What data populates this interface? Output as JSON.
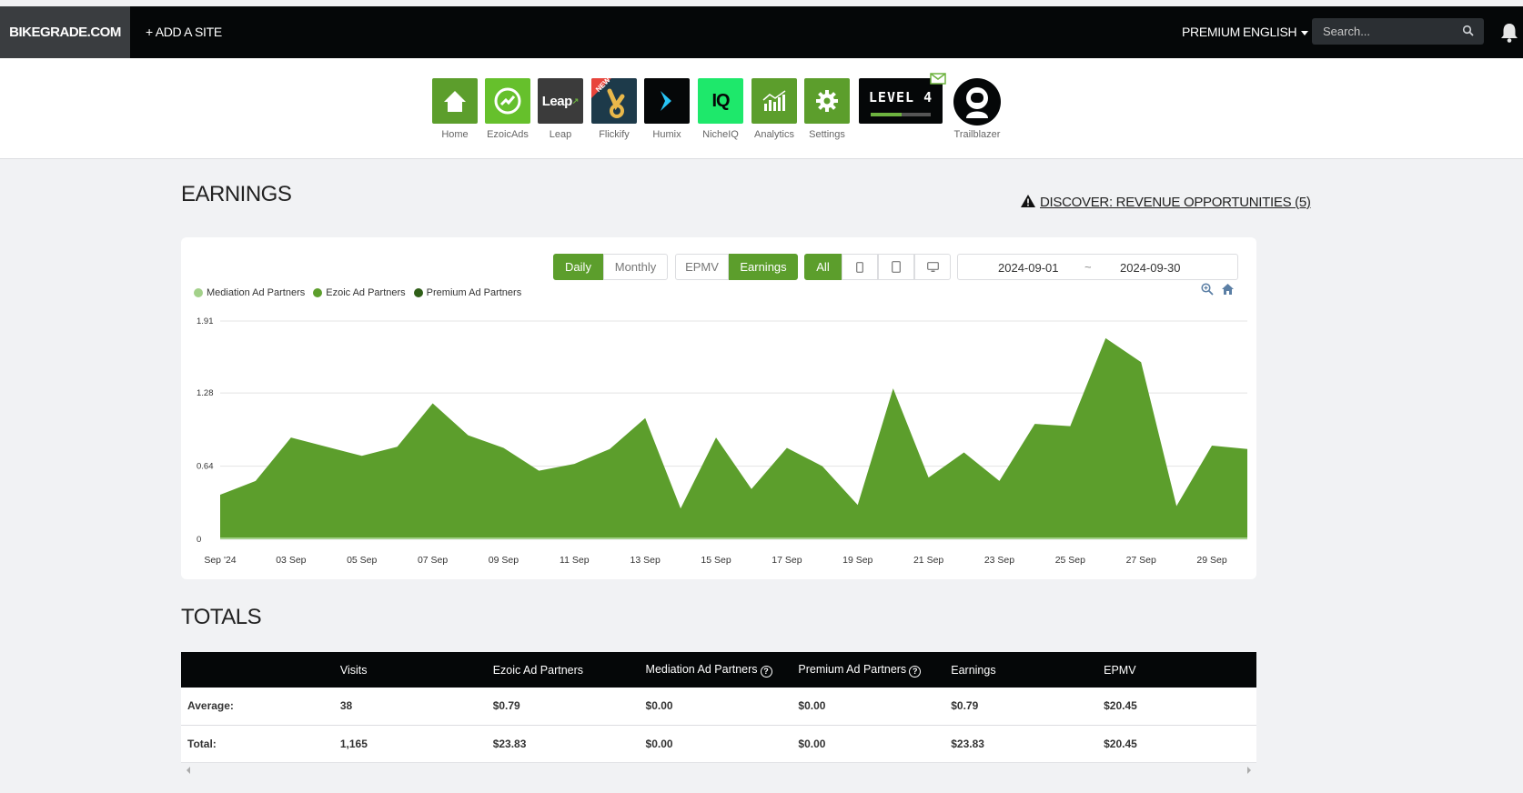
{
  "topbar": {
    "site_name": "BIKEGRADE.COM",
    "add_site": "+ ADD A SITE",
    "premium": "PREMIUM",
    "language": "ENGLISH",
    "search_placeholder": "Search..."
  },
  "apps": [
    {
      "label": "Home",
      "icon": "home-icon",
      "color": "#5c9e2c"
    },
    {
      "label": "EzoicAds",
      "icon": "ezoicads-icon",
      "color": "#66c02c"
    },
    {
      "label": "Leap",
      "icon": "leap-icon",
      "color": "#3b3b3b"
    },
    {
      "label": "Flickify",
      "icon": "flickify-icon",
      "color": "#1d3a4a",
      "badge": "NEW"
    },
    {
      "label": "Humix",
      "icon": "humix-icon",
      "color": "#050708"
    },
    {
      "label": "NicheIQ",
      "icon": "nicheiq-icon",
      "color": "#1ee86b"
    },
    {
      "label": "Analytics",
      "icon": "analytics-icon",
      "color": "#5c9e2c"
    },
    {
      "label": "Settings",
      "icon": "gear-icon",
      "color": "#5c9e2c"
    }
  ],
  "level": {
    "text": "LEVEL 4",
    "progress": 0.52
  },
  "trailblazer": {
    "label": "Trailblazer"
  },
  "earnings": {
    "heading": "EARNINGS",
    "discover": "DISCOVER: REVENUE OPPORTUNITIES (5)"
  },
  "controls": {
    "daily": "Daily",
    "monthly": "Monthly",
    "epmv": "EPMV",
    "earnings": "Earnings",
    "all": "All",
    "date_start": "2024-09-01",
    "date_sep": "~",
    "date_end": "2024-09-30"
  },
  "colors": {
    "accent": "#5c9e2c",
    "mediation": "#a3d18a",
    "ezoic": "#5c9e2c",
    "premium": "#2f5f18"
  },
  "chart_data": {
    "type": "area",
    "legend": [
      "Mediation Ad Partners",
      "Ezoic Ad Partners",
      "Premium Ad Partners"
    ],
    "x_tick_labels": [
      "Sep '24",
      "03 Sep",
      "05 Sep",
      "07 Sep",
      "09 Sep",
      "11 Sep",
      "13 Sep",
      "15 Sep",
      "17 Sep",
      "19 Sep",
      "21 Sep",
      "23 Sep",
      "25 Sep",
      "27 Sep",
      "29 Sep"
    ],
    "y_tick_labels": [
      "1.91",
      "1.28",
      "0.64",
      "0"
    ],
    "ylim": [
      0,
      1.91
    ],
    "x": [
      "2024-09-01",
      "2024-09-02",
      "2024-09-03",
      "2024-09-04",
      "2024-09-05",
      "2024-09-06",
      "2024-09-07",
      "2024-09-08",
      "2024-09-09",
      "2024-09-10",
      "2024-09-11",
      "2024-09-12",
      "2024-09-13",
      "2024-09-14",
      "2024-09-15",
      "2024-09-16",
      "2024-09-17",
      "2024-09-18",
      "2024-09-19",
      "2024-09-20",
      "2024-09-21",
      "2024-09-22",
      "2024-09-23",
      "2024-09-24",
      "2024-09-25",
      "2024-09-26",
      "2024-09-27",
      "2024-09-28",
      "2024-09-29",
      "2024-09-30"
    ],
    "series": [
      {
        "name": "Mediation Ad Partners",
        "values": [
          0,
          0,
          0,
          0,
          0,
          0,
          0,
          0,
          0,
          0,
          0,
          0,
          0,
          0,
          0,
          0,
          0,
          0,
          0,
          0,
          0,
          0,
          0,
          0,
          0,
          0,
          0,
          0,
          0,
          0
        ]
      },
      {
        "name": "Ezoic Ad Partners",
        "values": [
          0.39,
          0.51,
          0.89,
          0.81,
          0.73,
          0.81,
          1.19,
          0.91,
          0.8,
          0.6,
          0.66,
          0.79,
          1.06,
          0.27,
          0.89,
          0.44,
          0.8,
          0.64,
          0.3,
          1.32,
          0.54,
          0.76,
          0.51,
          1.01,
          0.99,
          1.76,
          1.55,
          0.29,
          0.82,
          0.79
        ]
      },
      {
        "name": "Premium Ad Partners",
        "values": [
          0,
          0,
          0,
          0,
          0,
          0,
          0,
          0,
          0,
          0,
          0,
          0,
          0,
          0,
          0,
          0,
          0,
          0,
          0,
          0,
          0,
          0,
          0,
          0,
          0,
          0,
          0,
          0,
          0,
          0
        ]
      }
    ]
  },
  "totals": {
    "heading": "TOTALS",
    "columns": [
      "",
      "Visits",
      "Ezoic Ad Partners",
      "Mediation Ad Partners",
      "Premium Ad Partners",
      "Earnings",
      "EPMV"
    ],
    "rows": [
      [
        "Average:",
        "38",
        "$0.79",
        "$0.00",
        "$0.00",
        "$0.79",
        "$20.45"
      ],
      [
        "Total:",
        "1,165",
        "$23.83",
        "$0.00",
        "$0.00",
        "$23.83",
        "$20.45"
      ]
    ]
  }
}
